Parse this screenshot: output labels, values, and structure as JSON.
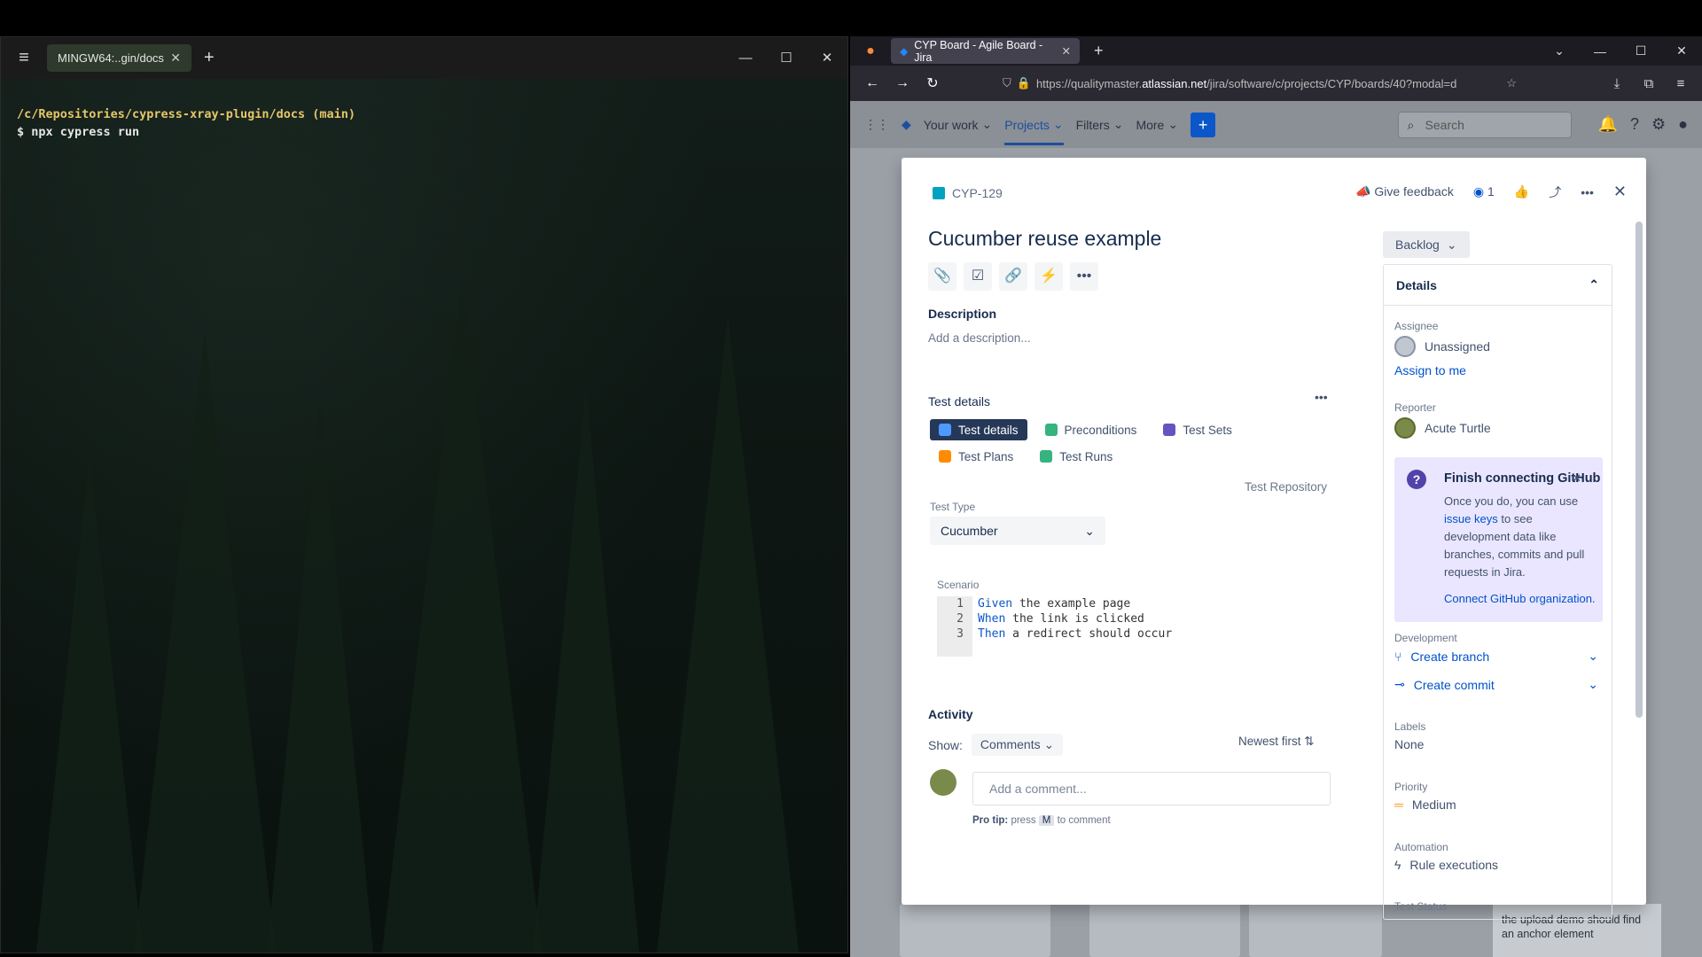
{
  "terminal": {
    "tab_title": "MINGW64:..gin/docs",
    "path_line": "/c/Repositories/cypress-xray-plugin/docs (main)",
    "command_line": "$ npx cypress run"
  },
  "browser": {
    "tab_title": "CYP Board - Agile Board - Jira",
    "url_prefix": "https://qualitymaster.",
    "url_domain": "atlassian.net",
    "url_rest": "/jira/software/c/projects/CYP/boards/40?modal=d"
  },
  "jira_nav": {
    "your_work": "Your work",
    "projects": "Projects",
    "filters": "Filters",
    "more": "More",
    "search_placeholder": "Search"
  },
  "issue": {
    "key": "CYP-129",
    "give_feedback": "Give feedback",
    "watchers": "1",
    "title": "Cucumber reuse example",
    "description_label": "Description",
    "description_placeholder": "Add a description...",
    "test_details_label": "Test details",
    "tabs": [
      "Test details",
      "Preconditions",
      "Test Sets",
      "Test Plans",
      "Test Runs"
    ],
    "test_repository": "Test Repository",
    "test_type_label": "Test Type",
    "test_type_value": "Cucumber",
    "scenario_label": "Scenario",
    "scenario": [
      {
        "ln": "1",
        "kw": "Given",
        "text": "the example page"
      },
      {
        "ln": "2",
        "kw": "When",
        "text": "the link is clicked"
      },
      {
        "ln": "3",
        "kw": "Then",
        "text": "a redirect should occur"
      }
    ],
    "activity_label": "Activity",
    "show_label": "Show:",
    "show_value": "Comments",
    "sort_label": "Newest first",
    "comment_placeholder": "Add a comment...",
    "protip_b": "Pro tip:",
    "protip_press": "press",
    "protip_key": "M",
    "protip_end": "to comment"
  },
  "sidebar": {
    "status": "Backlog",
    "details_label": "Details",
    "assignee_label": "Assignee",
    "assignee_value": "Unassigned",
    "assign_to_me": "Assign to me",
    "reporter_label": "Reporter",
    "reporter_value": "Acute Turtle",
    "gh_title": "Finish connecting GitHub",
    "gh_text_1": "Once you do, you can use",
    "gh_link": "issue keys",
    "gh_text_2": "to see development data like branches, commits and pull requests in Jira.",
    "gh_connect": "Connect GitHub organization.",
    "development_label": "Development",
    "create_branch": "Create branch",
    "create_commit": "Create commit",
    "labels_label": "Labels",
    "labels_value": "None",
    "priority_label": "Priority",
    "priority_value": "Medium",
    "automation_label": "Automation",
    "automation_value": "Rule executions",
    "test_status_label": "Test Status"
  },
  "background_card": "the upload demo should find an anchor element"
}
